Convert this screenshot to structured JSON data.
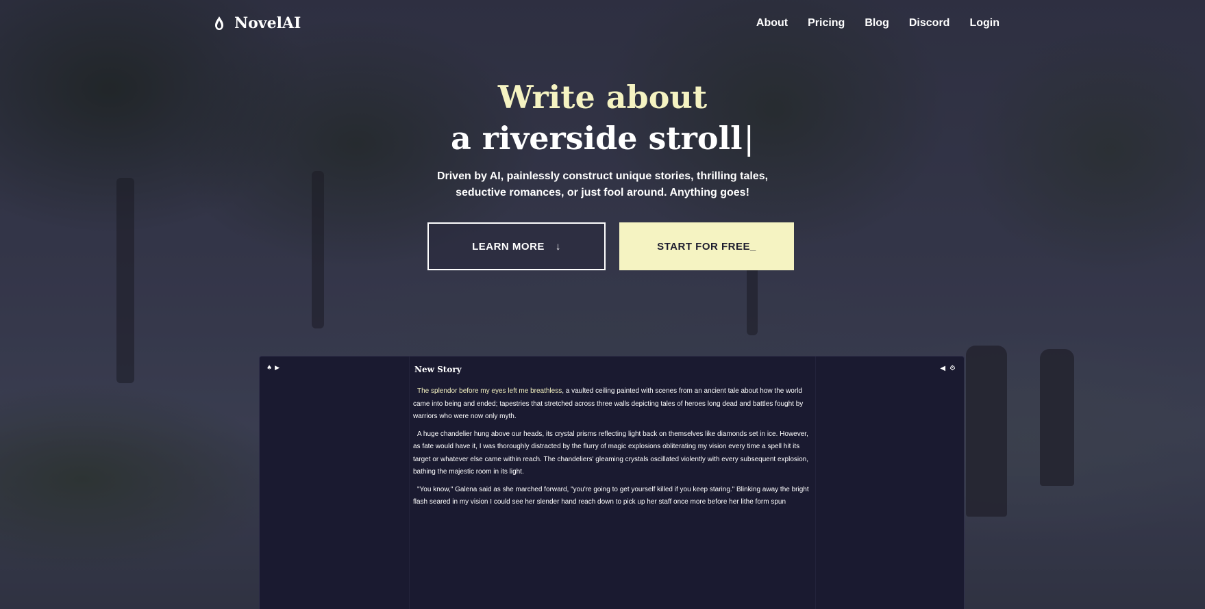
{
  "brand": {
    "name": "NovelAI",
    "logo_icon": "quill-flame-icon"
  },
  "nav": {
    "links": [
      "About",
      "Pricing",
      "Blog",
      "Discord",
      "Login"
    ]
  },
  "hero": {
    "line1": "Write about",
    "line2": "a riverside stroll",
    "cursor": "|",
    "subtitle_line1": "Driven by AI, painlessly construct unique stories, thrilling tales,",
    "subtitle_line2": "seductive romances, or just fool around. Anything goes!"
  },
  "cta": {
    "learn_more": "LEARN MORE",
    "learn_more_icon": "↓",
    "start_free": "START FOR FREE_"
  },
  "editor": {
    "title": "New Story",
    "left_icons": [
      "logo-icon",
      "chevron-right-icon"
    ],
    "right_icons": [
      "chevron-left-icon",
      "gear-icon"
    ],
    "paragraphs": [
      {
        "highlight": "The splendor before my eyes left me breathless",
        "text": ", a vaulted ceiling painted with scenes from an ancient tale about how the world came into being and ended; tapestries that stretched across three walls depicting tales of heroes long dead and battles fought by warriors who were now only myth."
      },
      {
        "highlight": "",
        "text": "A huge chandelier hung above our heads, its crystal prisms reflecting light back on themselves like diamonds set in ice. However, as fate would have it, I was thoroughly distracted by the flurry of magic explosions obliterating my vision every time a spell hit its target or whatever else came within reach. The chandeliers' gleaming crystals oscillated violently with every subsequent explosion, bathing the majestic room in its light."
      },
      {
        "highlight": "",
        "text": "\"You know,\" Galena said as she marched forward, \"you're going to get yourself killed if you keep staring.\" Blinking away the bright flash seared in my vision I could see her slender hand reach down to pick up her staff once more before her lithe form spun"
      }
    ]
  },
  "colors": {
    "accent": "#f5f3c2",
    "editor_bg": "#1a1a30",
    "text": "#ffffff"
  }
}
